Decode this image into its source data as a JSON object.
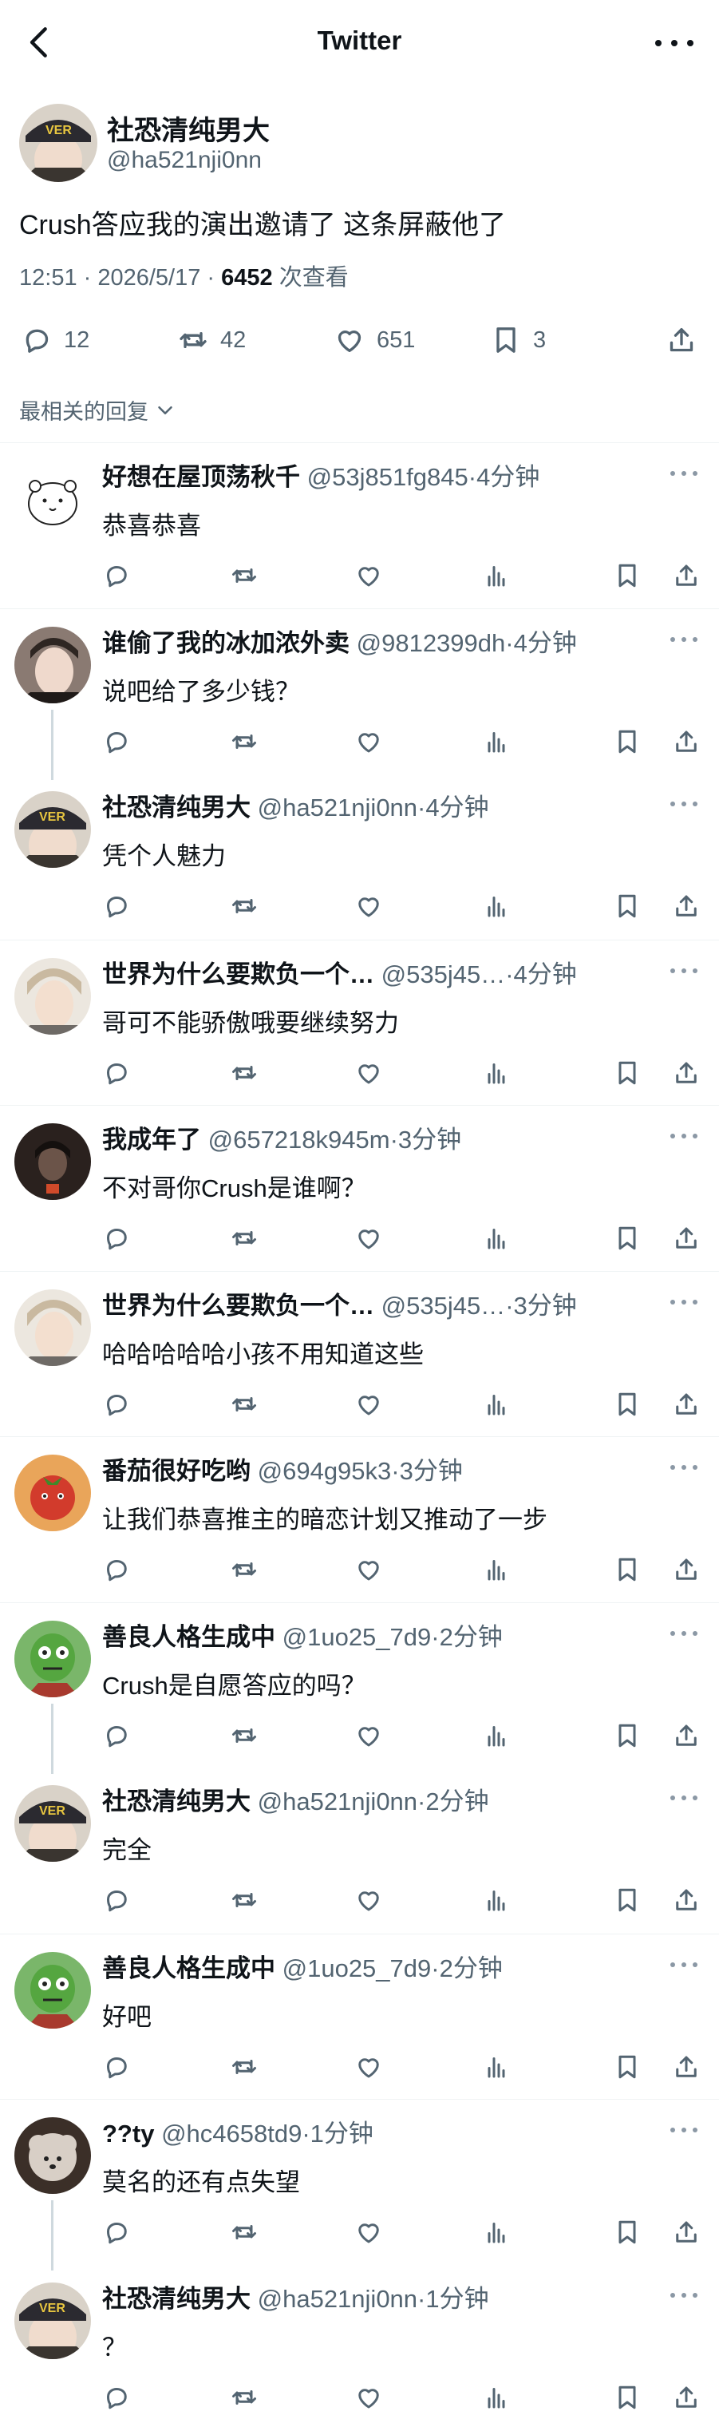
{
  "header": {
    "title": "Twitter"
  },
  "post": {
    "author_name": "社恐清纯男大",
    "author_handle": "@ha521nji0nn",
    "text": "Crush答应我的演出邀请了 这条屏蔽他了",
    "time_date": "12:51 · 2026/5/17 · ",
    "views_count": "6452",
    "views_label": " 次查看",
    "stats": {
      "replies": "12",
      "retweets": "42",
      "likes": "651",
      "bookmarks": "3"
    }
  },
  "sort_label": "最相关的回复",
  "avatar_colors": {
    "ha521": "#3a3530",
    "bear": "#ffffff",
    "ice": "#8a7a72",
    "blonde": "#c9b9a0",
    "dark": "#2a211e",
    "tomato": "#d23b2c",
    "zombie": "#55a640",
    "poodle": "#d8cfc6"
  },
  "replies": [
    {
      "name": "好想在屋顶荡秋千",
      "handle": "@53j851fg845",
      "time": "4分钟",
      "text": "恭喜恭喜",
      "avatar": "bear-avatar",
      "thread_next": false
    },
    {
      "name": "谁偷了我的冰加浓外卖",
      "handle": "@9812399dh",
      "time": "4分钟",
      "text": "说吧给了多少钱？",
      "avatar": "ice-avatar",
      "thread_next": true
    },
    {
      "name": "社恐清纯男大",
      "handle": "@ha521nji0nn",
      "time": "4分钟",
      "text": "凭个人魅力",
      "avatar": "author-avatar",
      "thread_next": false
    },
    {
      "name": "世界为什么要欺负一个…",
      "handle": "@535j45…",
      "time": "4分钟",
      "text": "哥可不能骄傲哦要继续努力",
      "avatar": "blonde-avatar",
      "thread_next": false
    },
    {
      "name": "我成年了",
      "handle": "@657218k945m",
      "time": "3分钟",
      "text": "不对哥你Crush是谁啊？",
      "avatar": "dark-avatar",
      "thread_next": false
    },
    {
      "name": "世界为什么要欺负一个…",
      "handle": "@535j45…",
      "time": "3分钟",
      "text": "哈哈哈哈哈小孩不用知道这些",
      "avatar": "blonde-avatar",
      "thread_next": false
    },
    {
      "name": "番茄很好吃哟",
      "handle": "@694g95k3",
      "time": "3分钟",
      "text": "让我们恭喜推主的暗恋计划又推动了一步",
      "avatar": "tomato-avatar",
      "thread_next": false
    },
    {
      "name": "善良人格生成中",
      "handle": "@1uo25_7d9",
      "time": "2分钟",
      "text": "Crush是自愿答应的吗？",
      "avatar": "zombie-avatar",
      "thread_next": true
    },
    {
      "name": "社恐清纯男大",
      "handle": "@ha521nji0nn",
      "time": "2分钟",
      "text": "完全",
      "avatar": "author-avatar",
      "thread_next": false
    },
    {
      "name": "善良人格生成中",
      "handle": "@1uo25_7d9",
      "time": "2分钟",
      "text": "好吧",
      "avatar": "zombie-avatar",
      "thread_next": false
    },
    {
      "name": "??ty",
      "handle": "@hc4658td9",
      "time": "1分钟",
      "text": "莫名的还有点失望",
      "avatar": "poodle-avatar",
      "thread_next": true
    },
    {
      "name": "社恐清纯男大",
      "handle": "@ha521nji0nn",
      "time": "1分钟",
      "text": "？",
      "avatar": "author-avatar",
      "thread_next": false
    }
  ]
}
